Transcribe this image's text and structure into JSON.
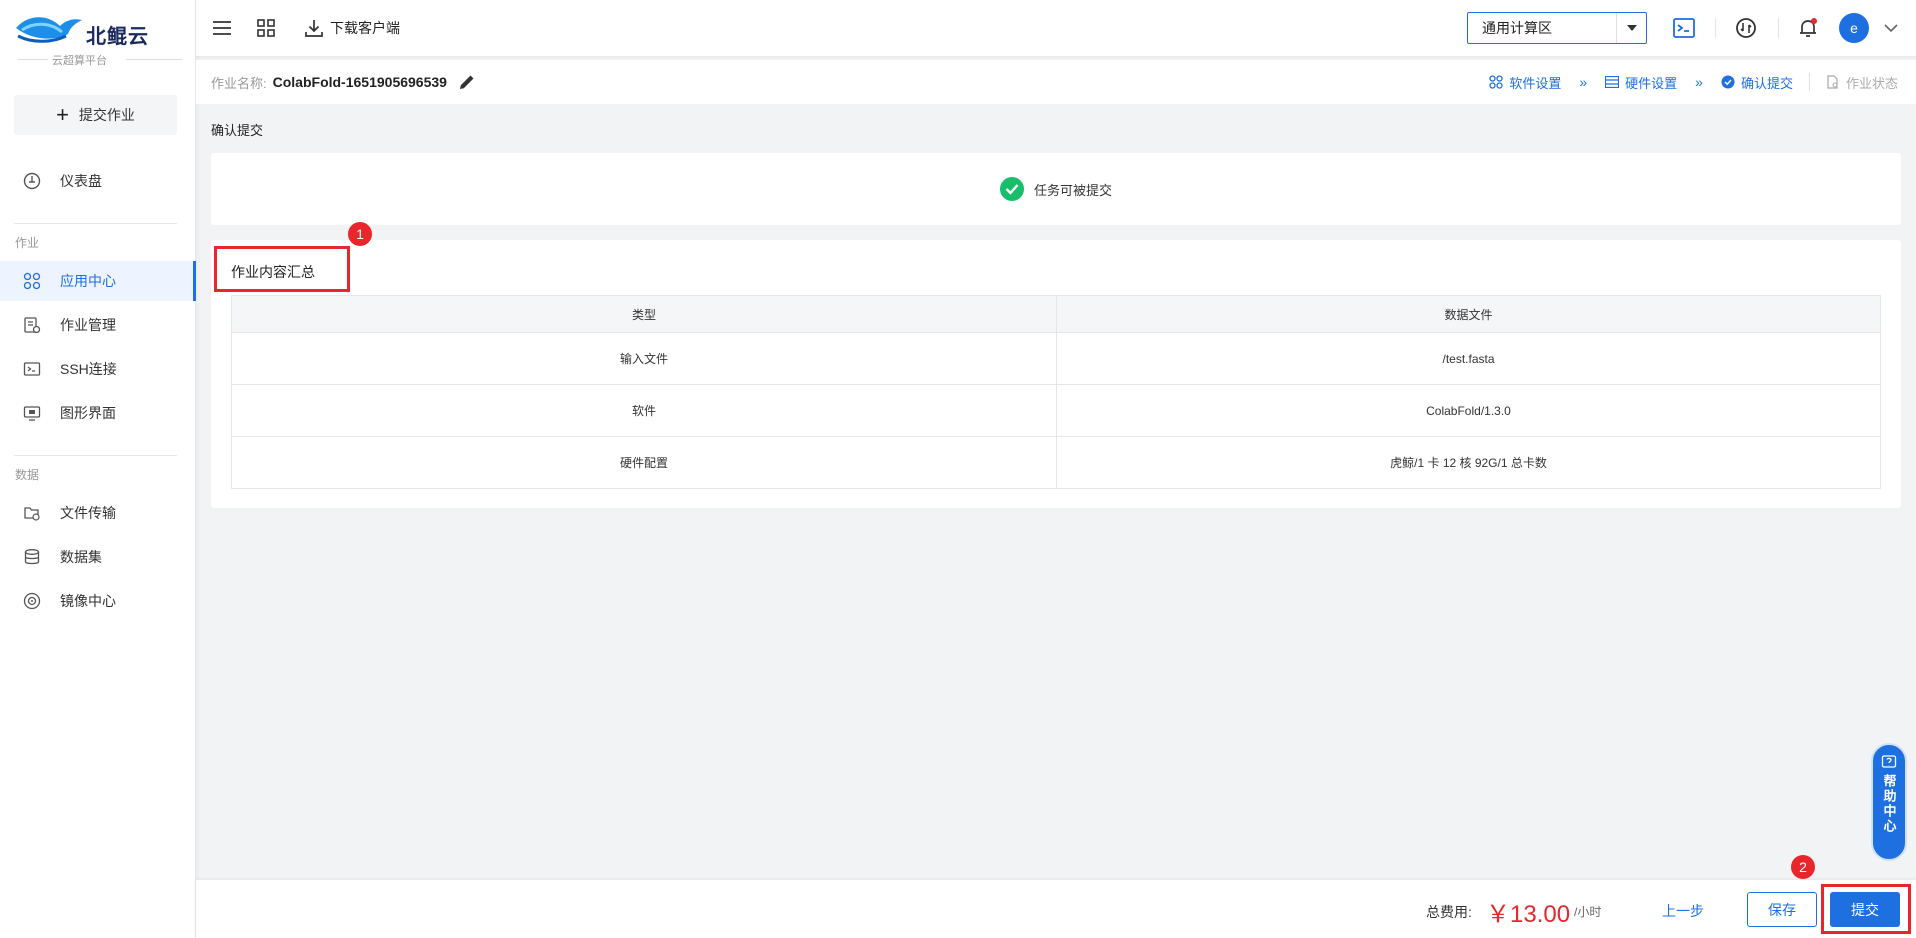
{
  "brand": {
    "name": "北鲲云",
    "subtitle": "云超算平台"
  },
  "sidebar": {
    "submit_job_label": "提交作业",
    "dashboard_label": "仪表盘",
    "section_job": "作业",
    "section_data": "数据",
    "items": [
      {
        "label": "应用中心",
        "active": true
      },
      {
        "label": "作业管理"
      },
      {
        "label": "SSH连接"
      },
      {
        "label": "图形界面"
      },
      {
        "label": "文件传输"
      },
      {
        "label": "数据集"
      },
      {
        "label": "镜像中心"
      }
    ]
  },
  "topbar": {
    "download_label": "下载客户端",
    "region": "通用计算区",
    "avatar_letter": "e"
  },
  "job": {
    "name_label": "作业名称:",
    "name": "ColabFold-1651905696539"
  },
  "steps": [
    {
      "label": "软件设置"
    },
    {
      "label": "硬件设置"
    },
    {
      "label": "确认提交"
    },
    {
      "label": "作业状态"
    }
  ],
  "section_title": "确认提交",
  "status_text": "任务可被提交",
  "summary": {
    "title": "作业内容汇总",
    "columns": [
      "类型",
      "数据文件"
    ],
    "rows": [
      [
        "输入文件",
        "/test.fasta"
      ],
      [
        "软件",
        "ColabFold/1.3.0"
      ],
      [
        "硬件配置",
        "虎鲸/1 卡 12 核 92G/1 总卡数"
      ]
    ]
  },
  "badges": [
    "1",
    "2"
  ],
  "footer": {
    "fee_label": "总费用:",
    "fee_value": "￥13.00",
    "fee_unit": "/小时",
    "prev_label": "上一步",
    "save_label": "保存",
    "submit_label": "提交"
  },
  "help": {
    "label": "帮助中心"
  },
  "colors": {
    "accent": "#1e6fe0",
    "danger": "#e8262b",
    "success": "#19be6b"
  }
}
